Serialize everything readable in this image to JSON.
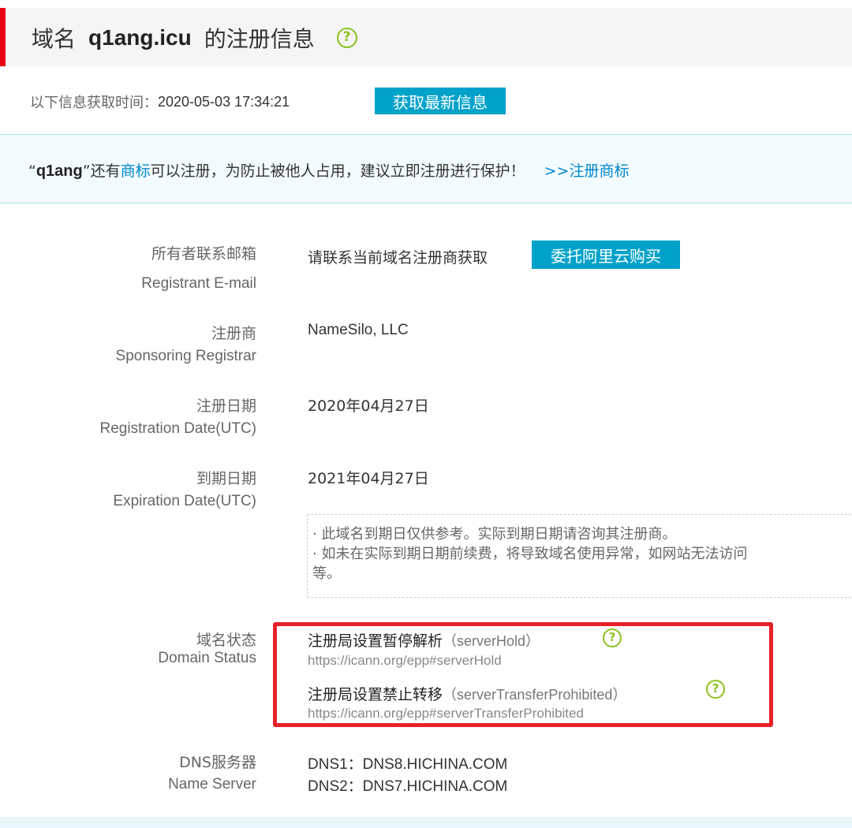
{
  "header": {
    "title_prefix": "域名",
    "domain": "q1ang.icu",
    "title_suffix": "的注册信息",
    "help_glyph": "?"
  },
  "fetch": {
    "label": "以下信息获取时间：",
    "time": "2020-05-03 17:34:21",
    "refresh_button": "获取最新信息"
  },
  "banner": {
    "open_quote": "“",
    "keyword": "q1ang",
    "text_before_link": "”还有",
    "inline_link": "商标",
    "text_after_link": "可以注册，为防止被他人占用，建议立即注册进行保护！",
    "cta_link": ">>注册商标"
  },
  "fields": {
    "email": {
      "label_cn": "所有者联系邮箱",
      "label_en": "Registrant E-mail",
      "value": "请联系当前域名注册商获取",
      "button": "委托阿里云购买"
    },
    "registrar": {
      "label_cn": "注册商",
      "label_en": "Sponsoring Registrar",
      "value": "NameSilo, LLC"
    },
    "reg_date": {
      "label_cn": "注册日期",
      "label_en": "Registration Date(UTC)",
      "value": "2020年04月27日"
    },
    "exp_date": {
      "label_cn": "到期日期",
      "label_en": "Expiration Date(UTC)",
      "value": "2021年04月27日"
    },
    "notice": {
      "line1": "· 此域名到期日仅供参考。实际到期日期请咨询其注册商。",
      "line2": "· 如未在实际到期日期前续费，将导致域名使用异常，如网站无法访问",
      "line3": "等。"
    },
    "status": {
      "label_cn": "域名状态",
      "label_en": "Domain Status",
      "items": [
        {
          "name": "注册局设置暂停解析",
          "code": "（serverHold）",
          "url": "https://icann.org/epp#serverHold"
        },
        {
          "name": "注册局设置禁止转移",
          "code": "（serverTransferProhibited）",
          "url": "https://icann.org/epp#serverTransferProhibited"
        }
      ]
    },
    "dns": {
      "label_cn": "DNS服务器",
      "label_en": "Name Server",
      "servers": [
        "DNS1：DNS8.HICHINA.COM",
        "DNS2：DNS7.HICHINA.COM"
      ]
    }
  },
  "colors": {
    "accent_red": "#e60012",
    "button_blue": "#00a2ca",
    "link_blue": "#0088cc",
    "help_green": "#8dc21f",
    "highlight_red": "#e8202a"
  }
}
